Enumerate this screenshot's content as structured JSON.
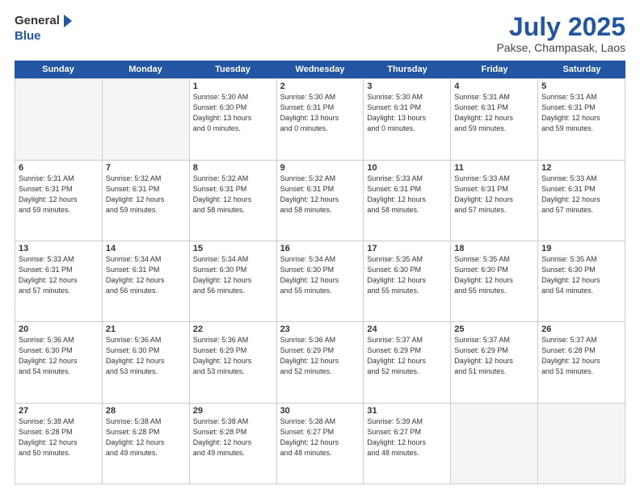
{
  "logo": {
    "general": "General",
    "blue": "Blue"
  },
  "header": {
    "month": "July 2025",
    "location": "Pakse, Champasak, Laos"
  },
  "days": [
    "Sunday",
    "Monday",
    "Tuesday",
    "Wednesday",
    "Thursday",
    "Friday",
    "Saturday"
  ],
  "rows": [
    [
      {
        "day": "",
        "empty": true
      },
      {
        "day": "",
        "empty": true
      },
      {
        "day": "1",
        "line1": "Sunrise: 5:30 AM",
        "line2": "Sunset: 6:30 PM",
        "line3": "Daylight: 13 hours",
        "line4": "and 0 minutes."
      },
      {
        "day": "2",
        "line1": "Sunrise: 5:30 AM",
        "line2": "Sunset: 6:31 PM",
        "line3": "Daylight: 13 hours",
        "line4": "and 0 minutes."
      },
      {
        "day": "3",
        "line1": "Sunrise: 5:30 AM",
        "line2": "Sunset: 6:31 PM",
        "line3": "Daylight: 13 hours",
        "line4": "and 0 minutes."
      },
      {
        "day": "4",
        "line1": "Sunrise: 5:31 AM",
        "line2": "Sunset: 6:31 PM",
        "line3": "Daylight: 12 hours",
        "line4": "and 59 minutes."
      },
      {
        "day": "5",
        "line1": "Sunrise: 5:31 AM",
        "line2": "Sunset: 6:31 PM",
        "line3": "Daylight: 12 hours",
        "line4": "and 59 minutes."
      }
    ],
    [
      {
        "day": "6",
        "line1": "Sunrise: 5:31 AM",
        "line2": "Sunset: 6:31 PM",
        "line3": "Daylight: 12 hours",
        "line4": "and 59 minutes."
      },
      {
        "day": "7",
        "line1": "Sunrise: 5:32 AM",
        "line2": "Sunset: 6:31 PM",
        "line3": "Daylight: 12 hours",
        "line4": "and 59 minutes."
      },
      {
        "day": "8",
        "line1": "Sunrise: 5:32 AM",
        "line2": "Sunset: 6:31 PM",
        "line3": "Daylight: 12 hours",
        "line4": "and 58 minutes."
      },
      {
        "day": "9",
        "line1": "Sunrise: 5:32 AM",
        "line2": "Sunset: 6:31 PM",
        "line3": "Daylight: 12 hours",
        "line4": "and 58 minutes."
      },
      {
        "day": "10",
        "line1": "Sunrise: 5:33 AM",
        "line2": "Sunset: 6:31 PM",
        "line3": "Daylight: 12 hours",
        "line4": "and 58 minutes."
      },
      {
        "day": "11",
        "line1": "Sunrise: 5:33 AM",
        "line2": "Sunset: 6:31 PM",
        "line3": "Daylight: 12 hours",
        "line4": "and 57 minutes."
      },
      {
        "day": "12",
        "line1": "Sunrise: 5:33 AM",
        "line2": "Sunset: 6:31 PM",
        "line3": "Daylight: 12 hours",
        "line4": "and 57 minutes."
      }
    ],
    [
      {
        "day": "13",
        "line1": "Sunrise: 5:33 AM",
        "line2": "Sunset: 6:31 PM",
        "line3": "Daylight: 12 hours",
        "line4": "and 57 minutes."
      },
      {
        "day": "14",
        "line1": "Sunrise: 5:34 AM",
        "line2": "Sunset: 6:31 PM",
        "line3": "Daylight: 12 hours",
        "line4": "and 56 minutes."
      },
      {
        "day": "15",
        "line1": "Sunrise: 5:34 AM",
        "line2": "Sunset: 6:30 PM",
        "line3": "Daylight: 12 hours",
        "line4": "and 56 minutes."
      },
      {
        "day": "16",
        "line1": "Sunrise: 5:34 AM",
        "line2": "Sunset: 6:30 PM",
        "line3": "Daylight: 12 hours",
        "line4": "and 55 minutes."
      },
      {
        "day": "17",
        "line1": "Sunrise: 5:35 AM",
        "line2": "Sunset: 6:30 PM",
        "line3": "Daylight: 12 hours",
        "line4": "and 55 minutes."
      },
      {
        "day": "18",
        "line1": "Sunrise: 5:35 AM",
        "line2": "Sunset: 6:30 PM",
        "line3": "Daylight: 12 hours",
        "line4": "and 55 minutes."
      },
      {
        "day": "19",
        "line1": "Sunrise: 5:35 AM",
        "line2": "Sunset: 6:30 PM",
        "line3": "Daylight: 12 hours",
        "line4": "and 54 minutes."
      }
    ],
    [
      {
        "day": "20",
        "line1": "Sunrise: 5:36 AM",
        "line2": "Sunset: 6:30 PM",
        "line3": "Daylight: 12 hours",
        "line4": "and 54 minutes."
      },
      {
        "day": "21",
        "line1": "Sunrise: 5:36 AM",
        "line2": "Sunset: 6:30 PM",
        "line3": "Daylight: 12 hours",
        "line4": "and 53 minutes."
      },
      {
        "day": "22",
        "line1": "Sunrise: 5:36 AM",
        "line2": "Sunset: 6:29 PM",
        "line3": "Daylight: 12 hours",
        "line4": "and 53 minutes."
      },
      {
        "day": "23",
        "line1": "Sunrise: 5:36 AM",
        "line2": "Sunset: 6:29 PM",
        "line3": "Daylight: 12 hours",
        "line4": "and 52 minutes."
      },
      {
        "day": "24",
        "line1": "Sunrise: 5:37 AM",
        "line2": "Sunset: 6:29 PM",
        "line3": "Daylight: 12 hours",
        "line4": "and 52 minutes."
      },
      {
        "day": "25",
        "line1": "Sunrise: 5:37 AM",
        "line2": "Sunset: 6:29 PM",
        "line3": "Daylight: 12 hours",
        "line4": "and 51 minutes."
      },
      {
        "day": "26",
        "line1": "Sunrise: 5:37 AM",
        "line2": "Sunset: 6:28 PM",
        "line3": "Daylight: 12 hours",
        "line4": "and 51 minutes."
      }
    ],
    [
      {
        "day": "27",
        "line1": "Sunrise: 5:38 AM",
        "line2": "Sunset: 6:28 PM",
        "line3": "Daylight: 12 hours",
        "line4": "and 50 minutes."
      },
      {
        "day": "28",
        "line1": "Sunrise: 5:38 AM",
        "line2": "Sunset: 6:28 PM",
        "line3": "Daylight: 12 hours",
        "line4": "and 49 minutes."
      },
      {
        "day": "29",
        "line1": "Sunrise: 5:38 AM",
        "line2": "Sunset: 6:28 PM",
        "line3": "Daylight: 12 hours",
        "line4": "and 49 minutes."
      },
      {
        "day": "30",
        "line1": "Sunrise: 5:38 AM",
        "line2": "Sunset: 6:27 PM",
        "line3": "Daylight: 12 hours",
        "line4": "and 48 minutes."
      },
      {
        "day": "31",
        "line1": "Sunrise: 5:39 AM",
        "line2": "Sunset: 6:27 PM",
        "line3": "Daylight: 12 hours",
        "line4": "and 48 minutes."
      },
      {
        "day": "",
        "empty": true
      },
      {
        "day": "",
        "empty": true
      }
    ]
  ]
}
